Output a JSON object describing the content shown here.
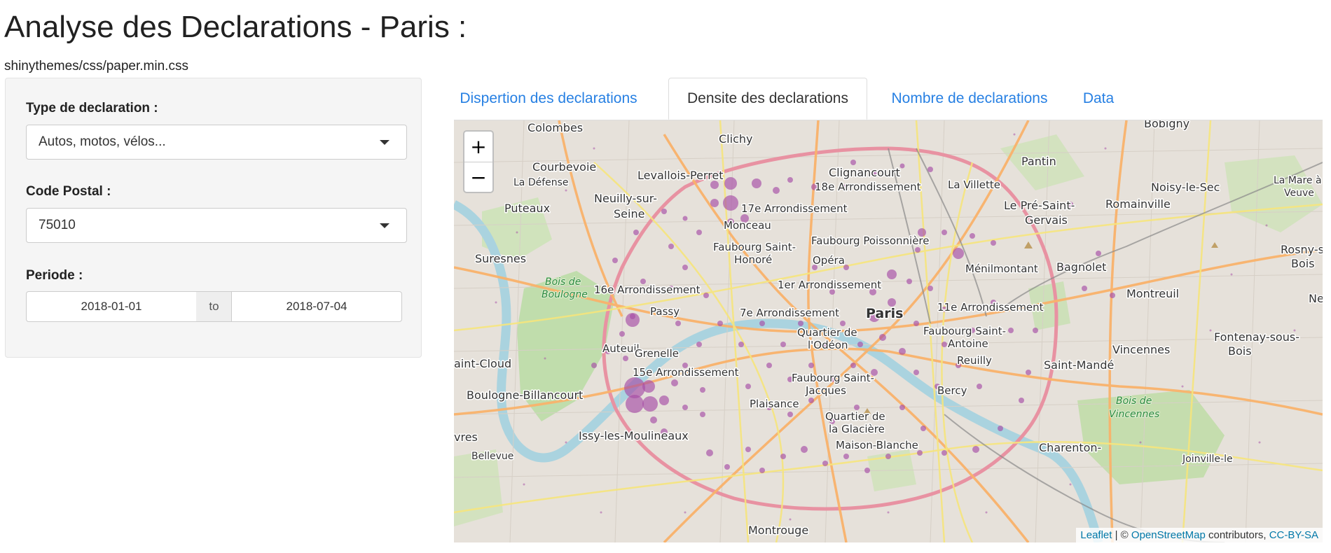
{
  "app": {
    "title": "Analyse des Declarations - Paris :",
    "theme_text": "shinythemes/css/paper.min.css"
  },
  "sidebar": {
    "type_label": "Type de declaration :",
    "type_value": "Autos, motos, vélos...",
    "postal_label": "Code Postal :",
    "postal_value": "75010",
    "period_label": "Periode :",
    "date_start": "2018-01-01",
    "date_sep": "to",
    "date_end": "2018-07-04"
  },
  "tabs": [
    {
      "label": "Dispertion des declarations",
      "active": false
    },
    {
      "label": "Densite des declarations",
      "active": true
    },
    {
      "label": "Nombre de declarations",
      "active": false
    },
    {
      "label": "Data",
      "active": false
    }
  ],
  "map": {
    "zoom_in": "+",
    "zoom_out": "−",
    "attribution": {
      "leaflet": "Leaflet",
      "sep": " | © ",
      "osm": "OpenStreetMap",
      "contributors": " contributors, ",
      "license": "CC-BY-SA"
    },
    "labels": {
      "colombes": "Colombes",
      "clichy": "Clichy",
      "bobigny": "Bobigny",
      "courbevoie": "Courbevoie",
      "levallois": "Levallois-Perret",
      "clignancourt": "Clignancourt",
      "pantin": "Pantin",
      "la_defense": "La Défense",
      "arr18": "18e Arrondissement",
      "la_villette": "La Villette",
      "noisy": "Noisy-le-Sec",
      "la_mare": "La Mare à",
      "veuve": "Veuve",
      "neuilly": "Neuilly-sur-",
      "seine": "Seine",
      "puteaux": "Puteaux",
      "arr17": "17e Arrondissement",
      "pre_saint": "Le Pré-Saint-",
      "gervais": "Gervais",
      "romainville": "Romainville",
      "monceau": "Monceau",
      "faubourg_poissonniere": "Faubourg Poissonnière",
      "faubourg_st_honore_1": "Faubourg Saint-",
      "faubourg_st_honore_2": "Honoré",
      "suresnes": "Suresnes",
      "opera": "Opéra",
      "rosny": "Rosny-sou",
      "bois_r": "Bois",
      "menilmontant": "Ménilmontant",
      "bagnolet": "Bagnolet",
      "bois_boulogne_1": "Bois de",
      "bois_boulogne_2": "Boulogne",
      "arr16": "16e Arrondissement",
      "arr1": "1er Arrondissement",
      "montreuil": "Montreuil",
      "passy": "Passy",
      "arr7": "7e Arrondissement",
      "paris": "Paris",
      "arr11": "11e Arrondissement",
      "ne": "Ne",
      "quartier_odeon_1": "Quartier de",
      "quartier_odeon_2": "l'Odéon",
      "faubourg_st_antoine_1": "Faubourg Saint-",
      "faubourg_st_antoine_2": "Antoine",
      "fontenay_1": "Fontenay-sous-",
      "fontenay_2": "Bois",
      "auteuil": "Auteuil",
      "grenelle": "Grenelle",
      "vincennes": "Vincennes",
      "saint_cloud": "aint-Cloud",
      "reuilly": "Reuilly",
      "saint_mande": "Saint-Mandé",
      "arr15": "15e Arrondissement",
      "faubourg_st_jacques_1": "Faubourg Saint-",
      "faubourg_st_jacques_2": "Jacques",
      "boulogne_billancourt": "Boulogne-Billancourt",
      "bercy": "Bercy",
      "bois_vincennes_1": "Bois de",
      "bois_vincennes_2": "Vincennes",
      "plaisance": "Plaisance",
      "quartier_glaciere_1": "Quartier de",
      "quartier_glaciere_2": "la Glacière",
      "issy": "Issy-les-Moulineaux",
      "vres": "vres",
      "charenton": "Charenton-",
      "bellevue": "Bellevue",
      "maison_blanche": "Maison-Blanche",
      "joinville": "Joinville-le",
      "montrouge": "Montrouge"
    },
    "density_color": "#a64ca6"
  }
}
